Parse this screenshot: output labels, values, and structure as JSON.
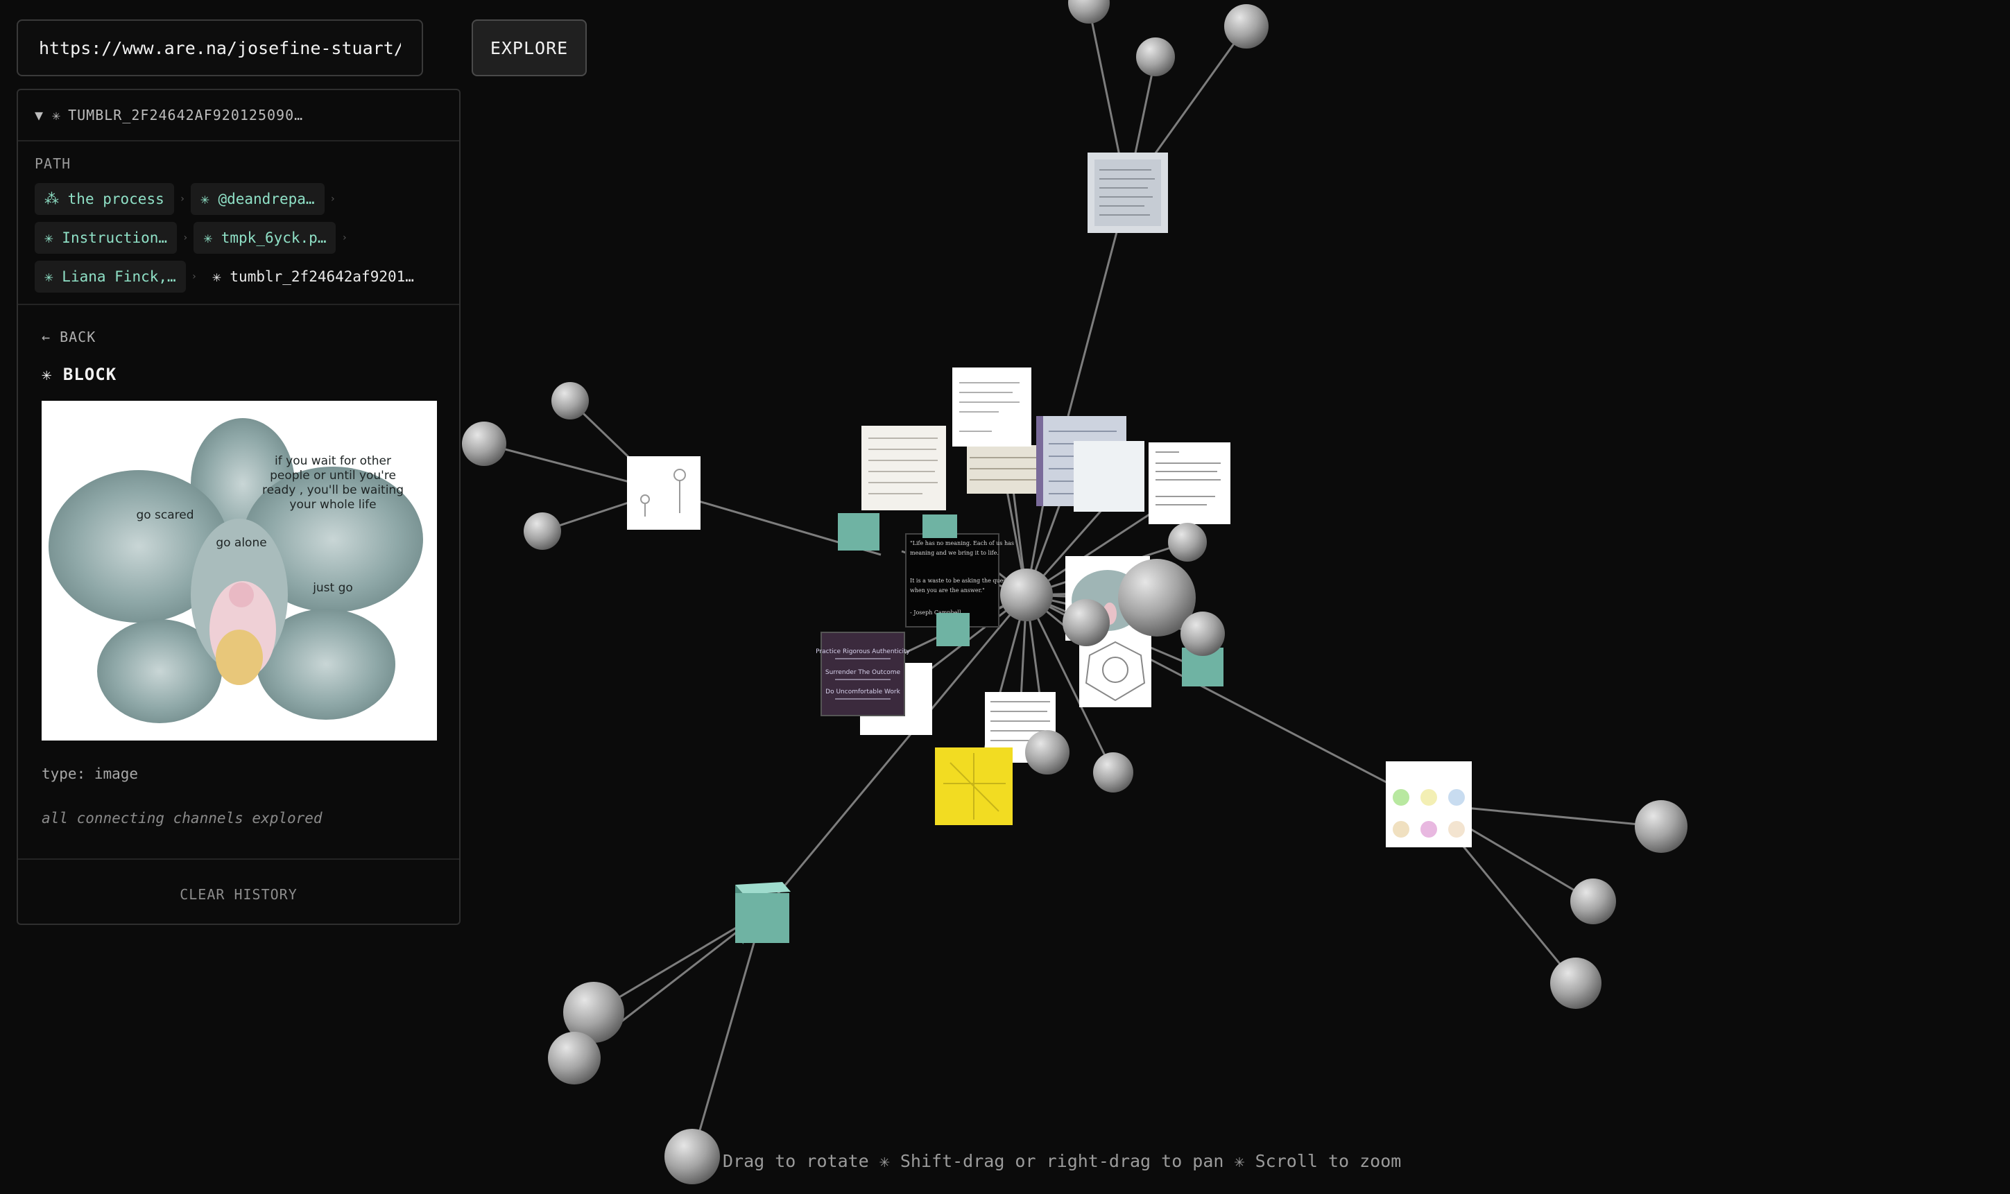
{
  "url_bar": {
    "value": "https://www.are.na/josefine-stuart/words-wi"
  },
  "explore_button": {
    "label": "EXPLORE"
  },
  "panel": {
    "header": {
      "label": "TUMBLR_2F24642AF920125090…"
    },
    "path_label": "PATH",
    "path": [
      {
        "label": "the process",
        "icon": "sparkles-icon"
      },
      {
        "label": "@deandrepa…",
        "icon": "asterisk-icon"
      },
      {
        "label": "Instruction…",
        "icon": "asterisk-icon"
      },
      {
        "label": "tmpk_6yck.p…",
        "icon": "asterisk-icon"
      },
      {
        "label": "Liana Finck,…",
        "icon": "asterisk-icon"
      },
      {
        "label": "tumblr_2f24642af9201…",
        "icon": "asterisk-icon",
        "current": true
      }
    ],
    "back_label": "← BACK",
    "block_title": "✳ BLOCK",
    "block_image": {
      "text_quote": "if you wait for other people or until you're ready , you'll be waiting your whole life",
      "text_scared": "go scared",
      "text_alone": "go alone",
      "text_just": "just go"
    },
    "type_line": "type: image",
    "explored_note": "all connecting channels explored",
    "clear_label": "CLEAR HISTORY"
  },
  "hint": "Drag to rotate ✳ Shift-drag or right-drag to pan ✳ Scroll to zoom",
  "graph_cards": {
    "quote_black": "\"Life has no meaning. Each of us has meaning and we bring it to life. It is a waste to be asking the question when you are the answer.\" - Joseph Campbell",
    "practice_1": "Practice Rigorous Authenticity",
    "practice_2": "Surrender The Outcome",
    "practice_3": "Do Uncomfortable Work"
  },
  "colors": {
    "background": "#0b0b0b",
    "accent": "#8fe0c6",
    "teal_cube": "#6fb3a3",
    "sphere": "#a8a8a8"
  }
}
